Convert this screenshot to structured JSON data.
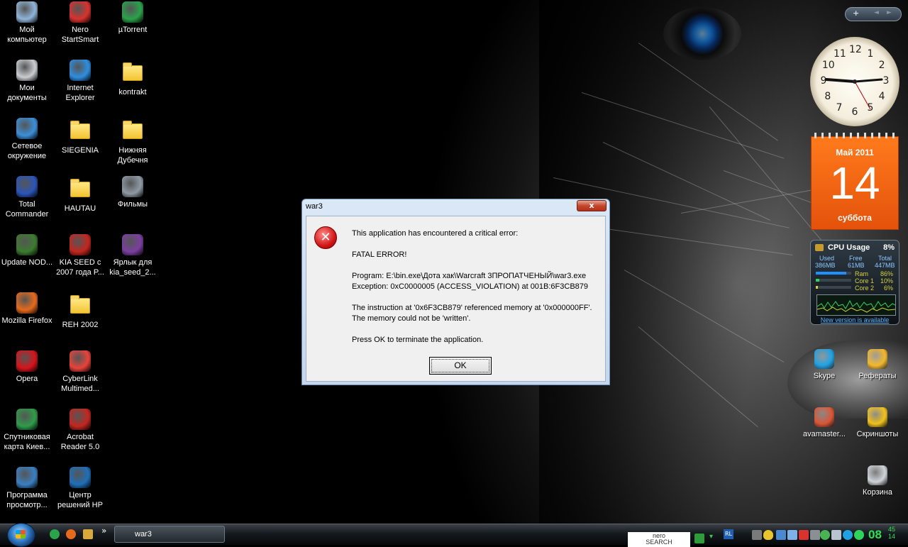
{
  "desktop": {
    "icons": [
      {
        "label": "Мой компьютер",
        "icon": "computer-icon",
        "color": "#8fb4d8"
      },
      {
        "label": "Nero StartSmart",
        "icon": "nero-icon",
        "color": "#d9322f"
      },
      {
        "label": "µTorrent",
        "icon": "utorrent-icon",
        "color": "#2aa34a"
      },
      {
        "label": "Мои документы",
        "icon": "documents-icon",
        "color": "#c9ccd1"
      },
      {
        "label": "Internet Explorer",
        "icon": "ie-icon",
        "color": "#2f8ee0"
      },
      {
        "label": "kontrakt",
        "icon": "folder-icon",
        "color": "#f4c430"
      },
      {
        "label": "Сетевое окружение",
        "icon": "network-icon",
        "color": "#3b8fd8"
      },
      {
        "label": "SIEGENIA",
        "icon": "folder-icon",
        "color": "#f4c430"
      },
      {
        "label": "Нижняя Дубечня",
        "icon": "folder-icon",
        "color": "#f4c430"
      },
      {
        "label": "Total Commander",
        "icon": "floppy-icon",
        "color": "#2c55b8"
      },
      {
        "label": "HAUTAU",
        "icon": "folder-icon",
        "color": "#f4c430"
      },
      {
        "label": "Фильмы",
        "icon": "camera-icon",
        "color": "#8f9aa6"
      },
      {
        "label": "Update NOD...",
        "icon": "nod-icon",
        "color": "#3c7b2f"
      },
      {
        "label": "KIA SEED с 2007 года P...",
        "icon": "pdf-icon",
        "color": "#c3261f"
      },
      {
        "label": "Ярлык для kia_seed_2...",
        "icon": "winrar-icon",
        "color": "#7a3fa0"
      },
      {
        "label": "Mozilla Firefox",
        "icon": "firefox-icon",
        "color": "#e66a1c"
      },
      {
        "label": "REH 2002",
        "icon": "folder-icon",
        "color": "#f4c430"
      },
      {
        "label": "Opera",
        "icon": "opera-icon",
        "color": "#d7131b"
      },
      {
        "label": "CyberLink Multimed...",
        "icon": "cyberlink-icon",
        "color": "#e8433a"
      },
      {
        "label": "Спутниковая карта Киев...",
        "icon": "globe-icon",
        "color": "#2f9c4b"
      },
      {
        "label": "Acrobat Reader 5.0",
        "icon": "acrobat-icon",
        "color": "#c3261f"
      },
      {
        "label": "Программа просмотр...",
        "icon": "viewer-icon",
        "color": "#3a7fc1"
      },
      {
        "label": "Центр решений HP",
        "icon": "hp-icon",
        "color": "#1f6fb8"
      }
    ],
    "right_icons": [
      {
        "label": "Skype",
        "icon": "skype-icon",
        "color": "#1fa1e3"
      },
      {
        "label": "Рефераты",
        "icon": "lock-icon",
        "color": "#f2b82a"
      },
      {
        "label": "avamaster...",
        "icon": "avamaster-icon",
        "color": "#d95636"
      },
      {
        "label": "Скриншоты",
        "icon": "star-icon",
        "color": "#f2c21a"
      },
      {
        "label": "Корзина",
        "icon": "recycle-bin-icon",
        "color": "#cfd4d9"
      }
    ]
  },
  "gadgets": {
    "bar": {
      "add": "+",
      "prev": "◄",
      "next": "►"
    },
    "clock": {
      "numbers": [
        "12",
        "1",
        "2",
        "3",
        "4",
        "5",
        "6",
        "7",
        "8",
        "9",
        "10",
        "11"
      ]
    },
    "calendar": {
      "month_year": "Май 2011",
      "day": "14",
      "weekday": "суббота"
    },
    "cpu": {
      "title": "CPU Usage",
      "percent": "8%",
      "headers": [
        "Used",
        "Free",
        "Total"
      ],
      "memory": [
        "386MB",
        "61MB",
        "447MB"
      ],
      "rows": [
        {
          "label": "Ram",
          "value": "86%",
          "fill": 0.86
        },
        {
          "label": "Core 1",
          "value": "10%",
          "fill": 0.1
        },
        {
          "label": "Core 2",
          "value": "6%",
          "fill": 0.06
        }
      ],
      "link": "New version is available"
    }
  },
  "dialog": {
    "title": "war3",
    "close": "x",
    "lines": [
      "This application has encountered a critical error:",
      "",
      "FATAL ERROR!",
      "",
      "Program:  E:\\bin.exe\\Дота хак\\Warcraft 3ПРОПАТЧЕНЫЙ\\war3.exe",
      "Exception: 0xC0000005 (ACCESS_VIOLATION) at 001B:6F3CB879",
      "",
      "The instruction at '0x6F3CB879' referenced memory at '0x000000FF'.",
      "The memory could not be 'written'.",
      "",
      "Press OK to terminate the application."
    ],
    "ok_label": "OK"
  },
  "taskbar": {
    "task_label": "war3",
    "nero_search": "nero\nSEARCH",
    "lang": "RL",
    "time": "08",
    "time_min": "45",
    "time_sec": "14",
    "quicklaunch_more": "»"
  }
}
